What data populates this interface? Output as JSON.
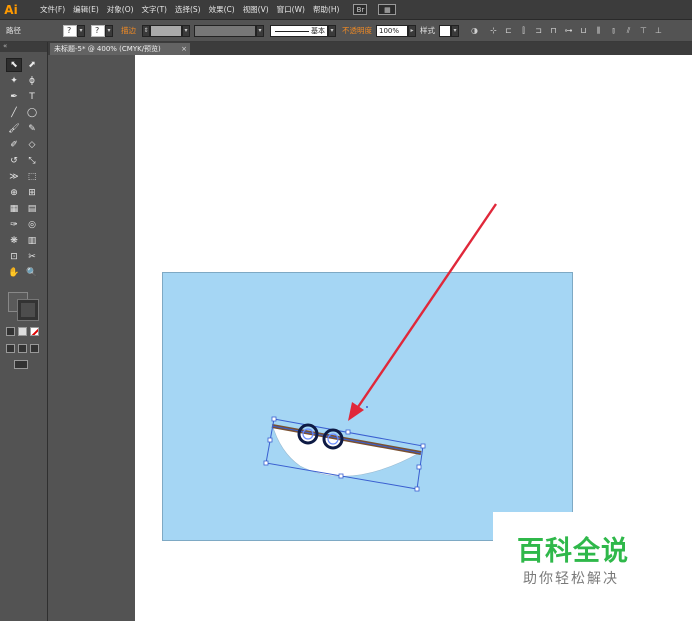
{
  "app": {
    "logo": "Ai"
  },
  "menu": [
    "文件(F)",
    "编辑(E)",
    "对象(O)",
    "文字(T)",
    "选择(S)",
    "效果(C)",
    "视图(V)",
    "窗口(W)",
    "帮助(H)"
  ],
  "control_bar": {
    "selection_label": "路径",
    "stroke_label": "描边",
    "brush_label": "基本",
    "opacity_label": "不透明度",
    "opacity_value": "100%",
    "style_label": "样式"
  },
  "document": {
    "tab_title": "未标题-5* @ 400% (CMYK/预览)",
    "close": "×"
  },
  "tools": [
    [
      "selection-tool",
      "direct-selection-tool"
    ],
    [
      "magic-wand-tool",
      "lasso-tool"
    ],
    [
      "pen-tool",
      "type-tool"
    ],
    [
      "line-tool",
      "ellipse-tool"
    ],
    [
      "paintbrush-tool",
      "pencil-tool"
    ],
    [
      "blob-brush-tool",
      "eraser-tool"
    ],
    [
      "rotate-tool",
      "scale-tool"
    ],
    [
      "width-tool",
      "free-transform-tool"
    ],
    [
      "shape-builder-tool",
      "perspective-grid-tool"
    ],
    [
      "mesh-tool",
      "gradient-tool"
    ],
    [
      "eyedropper-tool",
      "blend-tool"
    ],
    [
      "symbol-sprayer-tool",
      "column-graph-tool"
    ],
    [
      "artboard-tool",
      "slice-tool"
    ],
    [
      "hand-tool",
      "zoom-tool"
    ]
  ],
  "tool_glyphs": [
    [
      "⬉",
      "⬈"
    ],
    [
      "✦",
      "ϕ"
    ],
    [
      "✒",
      "T"
    ],
    [
      "╱",
      "◯"
    ],
    [
      "🖌",
      "✎"
    ],
    [
      "✐",
      "◇"
    ],
    [
      "↺",
      "⤡"
    ],
    [
      "≫",
      "⬚"
    ],
    [
      "⊕",
      "⊞"
    ],
    [
      "▦",
      "▤"
    ],
    [
      "✑",
      "◎"
    ],
    [
      "❋",
      "▥"
    ],
    [
      "⊡",
      "✂"
    ],
    [
      "✋",
      "🔍"
    ]
  ],
  "colors": {
    "art_fill": "#a5d6f4",
    "arrow": "#e0283a",
    "bbox": "#3a5fd0",
    "watermark_green": "#2fb84a"
  },
  "watermark": {
    "title": "百科全说",
    "subtitle": "助你轻松解决"
  }
}
